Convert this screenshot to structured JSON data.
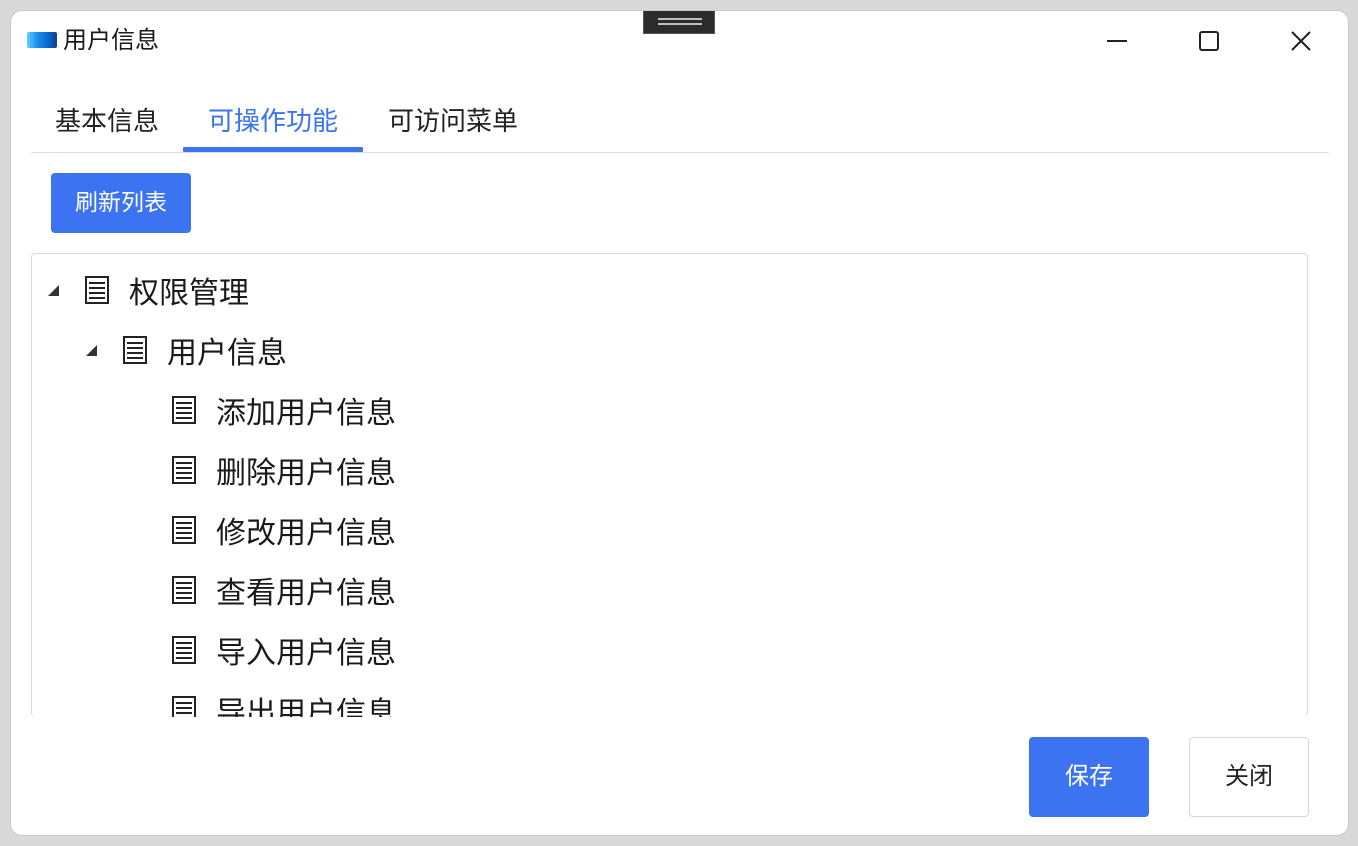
{
  "window": {
    "title": "用户信息",
    "controls": {
      "minimize_icon": "minimize-icon",
      "maximize_icon": "maximize-icon",
      "close_icon": "close-icon"
    }
  },
  "tabs": [
    {
      "label": "基本信息",
      "active": false
    },
    {
      "label": "可操作功能",
      "active": true
    },
    {
      "label": "可访问菜单",
      "active": false
    }
  ],
  "toolbar": {
    "refresh_label": "刷新列表"
  },
  "tree": {
    "nodes": [
      {
        "label": "权限管理",
        "level": 0,
        "expanded": true,
        "icon": "document-icon"
      },
      {
        "label": "用户信息",
        "level": 1,
        "expanded": true,
        "icon": "document-icon"
      },
      {
        "label": "添加用户信息",
        "level": 2,
        "icon": "document-icon"
      },
      {
        "label": "删除用户信息",
        "level": 2,
        "icon": "document-icon"
      },
      {
        "label": "修改用户信息",
        "level": 2,
        "icon": "document-icon"
      },
      {
        "label": "查看用户信息",
        "level": 2,
        "icon": "document-icon"
      },
      {
        "label": "导入用户信息",
        "level": 2,
        "icon": "document-icon"
      },
      {
        "label": "导出用户信息",
        "level": 2,
        "icon": "document-icon"
      }
    ]
  },
  "footer": {
    "save_label": "保存",
    "close_label": "关闭"
  },
  "colors": {
    "accent": "#3b73f0",
    "text": "#1a1a1a",
    "border": "#dadada"
  }
}
